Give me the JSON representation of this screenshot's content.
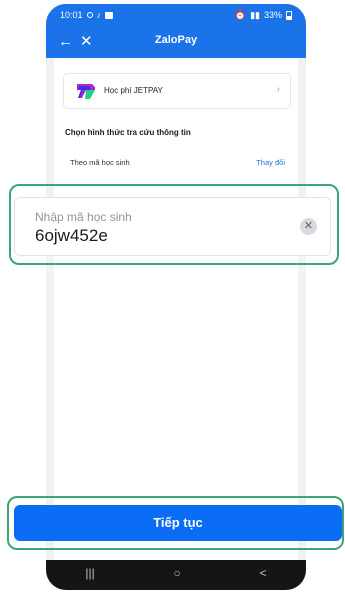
{
  "statusbar": {
    "time": "10:01",
    "right_text": "33%"
  },
  "navbar": {
    "title": "ZaloPay"
  },
  "school": {
    "name": "Học phí JETPAY"
  },
  "lookup": {
    "section_title": "Chọn hình thức tra cứu thông tin",
    "method_label": "Theo mã học sinh",
    "change_label": "Thay đổi"
  },
  "input": {
    "label": "Nhập mã học sinh",
    "value": "6ojw452e"
  },
  "action": {
    "continue_label": "Tiếp tục"
  },
  "sysnav": {
    "recent": "|||",
    "home": "○",
    "back": "<"
  }
}
